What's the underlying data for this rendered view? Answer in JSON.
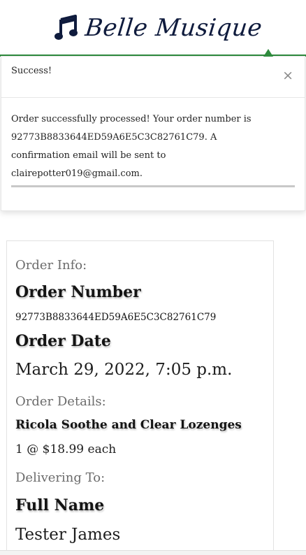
{
  "header": {
    "brand_name": "Belle Musique",
    "brand_icon": "music-note-icon",
    "accent_color": "#2e8b3d",
    "brand_color": "#0f1b3d"
  },
  "toast": {
    "title": "Success!",
    "close_glyph": "×",
    "message_line1": "Order successfully processed! Your order number is",
    "message_line2": "92773B8833644ED59A6E5C3C82761C79. A",
    "message_line3": "confirmation email will be sent to",
    "message_line4": "clairepotter019@gmail.com."
  },
  "order": {
    "info_heading": "Order Info:",
    "number_label": "Order Number",
    "number_value": "92773B8833644ED59A6E5C3C82761C79",
    "date_label": "Order Date",
    "date_value": "March 29, 2022, 7:05 p.m.",
    "details_heading": "Order Details:",
    "items": [
      {
        "name": "Ricola Soothe and Clear Lozenges",
        "quantity_line": "1 @ $18.99 each"
      }
    ],
    "delivery_heading": "Delivering To:",
    "full_name_label": "Full Name",
    "full_name_value": "Tester James"
  }
}
